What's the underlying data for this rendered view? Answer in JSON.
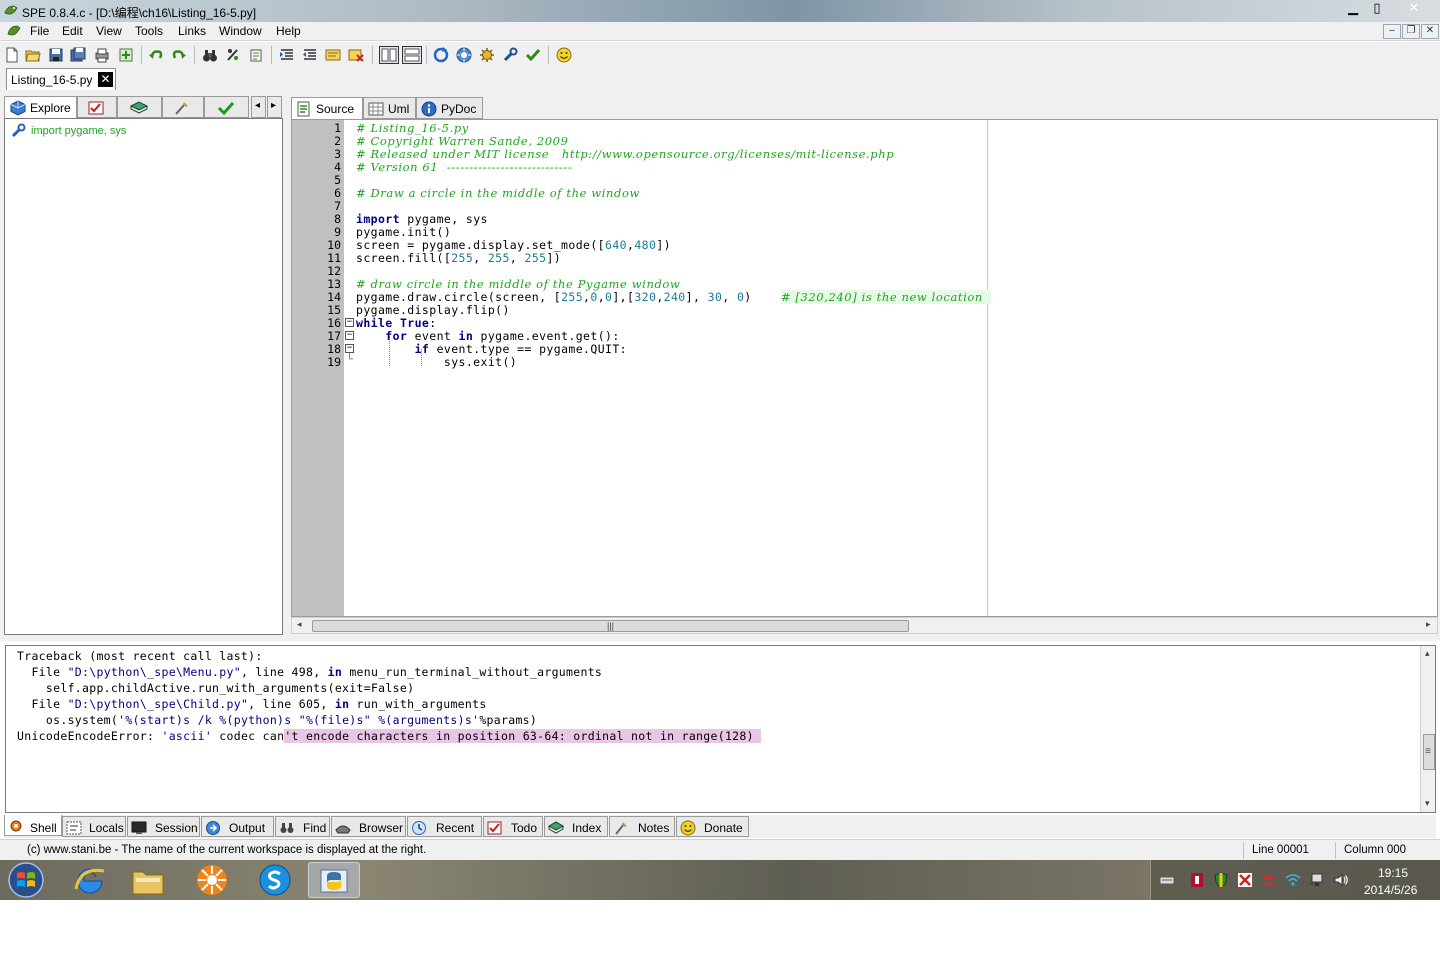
{
  "window": {
    "title": "SPE 0.8.4.c - [D:\\编程\\ch16\\Listing_16-5.py]",
    "min_glyph": "▁",
    "max_glyph": "▯",
    "close_glyph": "✕"
  },
  "menubar": {
    "items": [
      "File",
      "Edit",
      "View",
      "Tools",
      "Links",
      "Window",
      "Help"
    ],
    "mdi_min": "–",
    "mdi_restore": "❐",
    "mdi_close": "✕"
  },
  "file_tabs": [
    {
      "label": "Listing_16-5.py",
      "close": "✕"
    }
  ],
  "left_tabs": {
    "explore": "Explore",
    "nav_left": "◂",
    "nav_right": "▸"
  },
  "explore": {
    "items": [
      "import pygame, sys"
    ]
  },
  "editor_tabs": [
    "Source",
    "Uml",
    "PyDoc"
  ],
  "editor": {
    "line_numbers": [
      "1",
      "2",
      "3",
      "4",
      "5",
      "6",
      "7",
      "8",
      "9",
      "10",
      "11",
      "12",
      "13",
      "14",
      "15",
      "16",
      "17",
      "18",
      "19"
    ],
    "fold_open": "−",
    "fold_end": "└",
    "code": {
      "l1": "# Listing_16-5.py",
      "l2": "# Copyright Warren Sande, 2009",
      "l3": "# Released under MIT license   http://www.opensource.org/licenses/mit-license.php",
      "l4": "# Version 61  ----------------------------",
      "l6": "# Draw a circle in the middle of the window",
      "l8_kw": "import",
      "l8_rest": " pygame, sys",
      "l9": "pygame.init()",
      "l10_a": "screen = pygame.display.set_mode([",
      "l10_n1": "640",
      "l10_b": ",",
      "l10_n2": "480",
      "l10_c": "])",
      "l11_a": "screen.fill([",
      "l11_n1": "255",
      "l11_b": ", ",
      "l11_n2": "255",
      "l11_c": ", ",
      "l11_n3": "255",
      "l11_d": "])",
      "l13": "# draw circle in the middle of the Pygame window",
      "l14_a": "pygame.draw.circle(screen, [",
      "l14_n1": "255",
      "l14_b": ",",
      "l14_n2": "0",
      "l14_c": ",",
      "l14_n3": "0",
      "l14_d": "],[",
      "l14_n4": "320",
      "l14_e": ",",
      "l14_n5": "240",
      "l14_f": "], ",
      "l14_n6": "30",
      "l14_g": ", ",
      "l14_n7": "0",
      "l14_h": ")    ",
      "l14_cmt": "# [320,240] is the new location  ",
      "l15": "pygame.display.flip()",
      "l16_kw1": "while",
      "l16_kw2": "True",
      "l16_rest": ":",
      "l17_kw1": "for",
      "l17_mid": " event ",
      "l17_kw2": "in",
      "l17_rest": " pygame.event.get():",
      "l18_kw": "if",
      "l18_rest": " event.type == pygame.QUIT:",
      "l19": "sys.exit()"
    }
  },
  "hscroll": {
    "grip": "|||",
    "left": "◂",
    "right": "▸"
  },
  "shell": {
    "l1": "Traceback (most recent call last):",
    "l2_a": "  File ",
    "l2_str": "\"D:\\python\\_spe\\Menu.py\"",
    "l2_b": ", line 498, ",
    "l2_kw": "in",
    "l2_c": " menu_run_terminal_without_arguments",
    "l3": "    self.app.childActive.run_with_arguments(exit=False)",
    "l4_a": "  File ",
    "l4_str": "\"D:\\python\\_spe\\Child.py\"",
    "l4_b": ", line 605, ",
    "l4_kw": "in",
    "l4_c": " run_with_arguments",
    "l5_a": "    os.system(",
    "l5_str": "'%(start)s /k %(python)s \"%(file)s\" %(arguments)s'",
    "l5_b": "%params)",
    "l6_a": "UnicodeEncodeError: ",
    "l6_str": "'ascii'",
    "l6_b": " codec can",
    "l6_hl": "'t encode characters in position 63-64: ordinal not in range(128) ",
    "up": "▴",
    "down": "▾",
    "grip": "≡"
  },
  "bottom_tabs": [
    "Shell",
    "Locals",
    "Session",
    "Output",
    "Find",
    "Browser",
    "Recent",
    "Todo",
    "Index",
    "Notes",
    "Donate"
  ],
  "status": {
    "message": "(c) www.stani.be - The name of the current workspace is displayed at the right.",
    "line": "Line 00001",
    "column": "Column 000"
  },
  "taskbar": {
    "time": "19:15",
    "date": "2014/5/26"
  },
  "colors": {
    "comment": "#1ea51e",
    "keyword": "#000080",
    "number": "#1c7a9a",
    "highlight": "#e9c6e6"
  }
}
